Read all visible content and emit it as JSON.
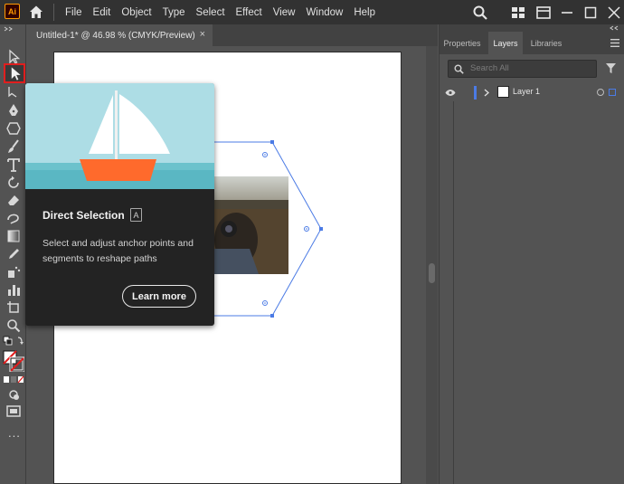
{
  "app": {
    "logo": "Ai"
  },
  "menu": [
    "File",
    "Edit",
    "Object",
    "Type",
    "Select",
    "Effect",
    "View",
    "Window",
    "Help"
  ],
  "document": {
    "tab_title": "Untitled-1* @ 46.98 % (CMYK/Preview)",
    "close": "×"
  },
  "tooltip": {
    "title": "Direct Selection",
    "shortcut": "A",
    "description": "Select and adjust anchor points and segments to reshape paths",
    "button": "Learn more"
  },
  "panel": {
    "tabs": [
      "Properties",
      "Layers",
      "Libraries"
    ],
    "active_tab": "Layers",
    "search_placeholder": "Search All",
    "layers": [
      {
        "name": "Layer 1"
      }
    ]
  },
  "toolbar": {
    "more": "..."
  },
  "colors": {
    "selection_outline": "#e01e1e",
    "path_blue": "#4b7be5",
    "ai_orange": "#ff9a00"
  }
}
